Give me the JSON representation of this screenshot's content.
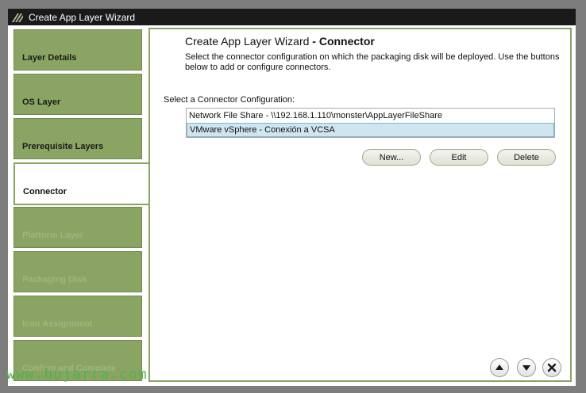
{
  "window": {
    "title": "Create App Layer Wizard"
  },
  "sidebar": {
    "steps": [
      {
        "label": "Layer Details",
        "state": "done"
      },
      {
        "label": "OS Layer",
        "state": "done"
      },
      {
        "label": "Prerequisite Layers",
        "state": "done"
      },
      {
        "label": "Connector",
        "state": "active"
      },
      {
        "label": "Platform Layer",
        "state": "todo"
      },
      {
        "label": "Packaging Disk",
        "state": "todo"
      },
      {
        "label": "Icon Assignment",
        "state": "todo"
      },
      {
        "label": "Confirm and Complete",
        "state": "todo"
      }
    ]
  },
  "main": {
    "heading_prefix": "Create App Layer Wizard",
    "heading_suffix": " - Connector",
    "description": "Select the connector configuration on which the packaging disk will be deployed.  Use the buttons below to add or configure connectors.",
    "select_label": "Select a Connector Configuration:",
    "connectors": [
      {
        "label": "Network File Share - \\\\192.168.1.110\\monster\\AppLayerFileShare",
        "selected": false
      },
      {
        "label": "VMware vSphere - Conexión a VCSA",
        "selected": true
      }
    ],
    "buttons": {
      "new": "New...",
      "edit": "Edit",
      "delete": "Delete"
    }
  },
  "watermark": "www.bujarra.com",
  "colors": {
    "accent_green": "#8aa464",
    "selected_row": "#cfe6ef",
    "title_bar": "#1a1a1a"
  },
  "icons": {
    "app_logo": "stripes-logo-icon",
    "up": "arrow-up-icon",
    "down": "arrow-down-icon",
    "close": "close-x-icon"
  }
}
